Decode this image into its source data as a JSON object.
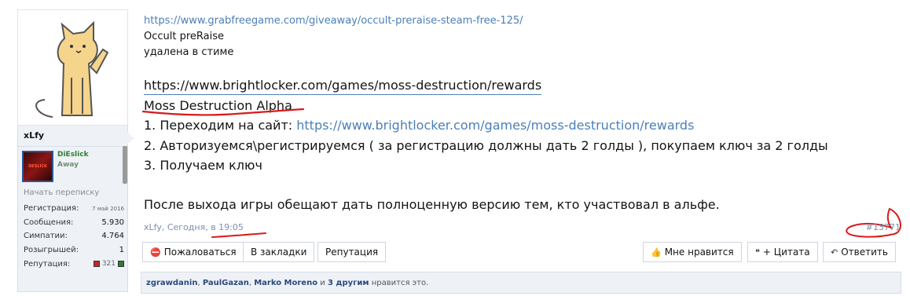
{
  "user": {
    "username": "xLfy",
    "signature_name": "DiEslick",
    "signature_status": "Away",
    "signature_img_text": "DESLICK",
    "start_conversation": "Начать переписку",
    "stats": [
      {
        "label": "Регистрация:",
        "value": "7 май 2016"
      },
      {
        "label": "Сообщения:",
        "value": "5.930"
      },
      {
        "label": "Симпатии:",
        "value": "4.764"
      },
      {
        "label": "Розыгрышей:",
        "value": "1"
      },
      {
        "label": "Репутация:",
        "value": "321"
      }
    ]
  },
  "post": {
    "lines": {
      "url1": "https://www.grabfreegame.com/giveaway/occult-preraise-steam-free-125/",
      "game1": "Occult preRaise",
      "removed": "удалена в стиме",
      "url2": "https://www.brightlocker.com/games/moss-destruction/rewards",
      "game2": "Moss Destruction Alpha",
      "step1_prefix": "1. Переходим на сайт: ",
      "step1_link": "https://www.brightlocker.com/games/moss-destruction/rewards",
      "step2": "2. Авторизуемся\\регистрируемся ( за регистрацию должны дать 2 голды ), покупаем ключ за 2 голды",
      "step3": "3. Получаем ключ",
      "note": "После выхода игры обещают дать полноценную версию тем, кто участвовал в альфе."
    },
    "meta": {
      "author": "xLfy",
      "sep": ", ",
      "day": "Сегодня",
      "time": "в 19:05"
    },
    "post_number": "#13771"
  },
  "actions": {
    "report": "Пожаловаться",
    "bookmark": "В закладки",
    "reputation": "Репутация",
    "like": "Мне нравится",
    "quote": "+ Цитата",
    "reply": "Ответить"
  },
  "likes": {
    "users": [
      "zgrawdanin",
      "PaulGazan",
      "Marko Moreno"
    ],
    "sep": ", ",
    "and": " и ",
    "others": "3 другим",
    "suffix": " нравится это."
  },
  "colors": {
    "link": "#4b7fb8",
    "annotation": "#d81b1b",
    "panel": "#eef2f7"
  },
  "icons": [
    "cat-avatar",
    "report-icon",
    "thumbs-up-icon",
    "quote-icon",
    "reply-icon"
  ]
}
